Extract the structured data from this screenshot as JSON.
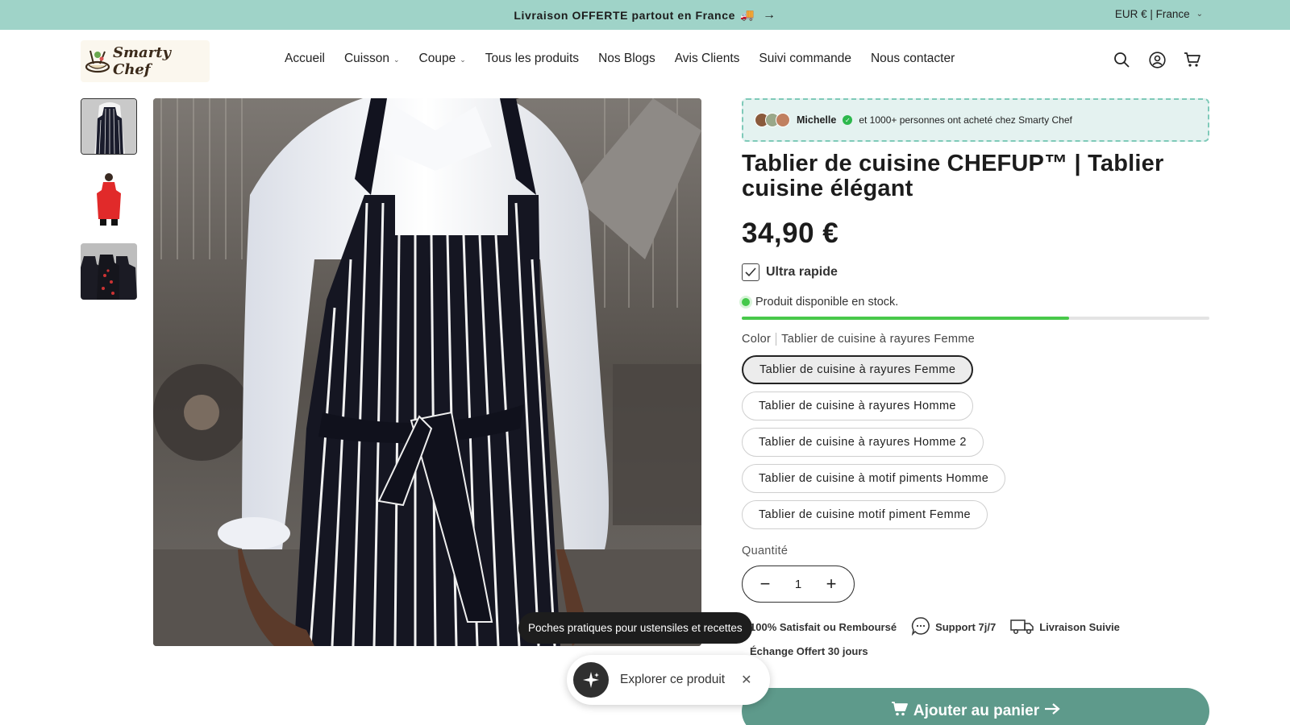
{
  "announcement": {
    "text": "Livraison OFFERTE partout en France",
    "emoji": "🚚",
    "arrow": "→"
  },
  "locale": {
    "label": "EUR € | France"
  },
  "logo": {
    "text": "Smarty Chef"
  },
  "nav": {
    "items": [
      {
        "label": "Accueil",
        "dropdown": false
      },
      {
        "label": "Cuisson",
        "dropdown": true
      },
      {
        "label": "Coupe",
        "dropdown": true
      },
      {
        "label": "Tous les produits",
        "dropdown": false
      },
      {
        "label": "Nos Blogs",
        "dropdown": false
      },
      {
        "label": "Avis Clients",
        "dropdown": false
      },
      {
        "label": "Suivi commande",
        "dropdown": false
      },
      {
        "label": "Nous contacter",
        "dropdown": false
      }
    ]
  },
  "header_icons": [
    "search-icon",
    "account-icon",
    "cart-icon"
  ],
  "product": {
    "social_proof": {
      "name": "Michelle",
      "text": "et 1000+ personnes ont acheté chez Smarty Chef"
    },
    "title": "Tablier de cuisine CHEFUP™ | Tablier cuisine élégant",
    "price": "34,90 €",
    "fast_label": "Ultra rapide",
    "stock_text": "Produit disponible en stock.",
    "stock_level": 0.7,
    "color_label": "Color",
    "selected_color": "Tablier de cuisine à rayures Femme",
    "variants": [
      "Tablier de cuisine à rayures Femme",
      "Tablier de cuisine à rayures Homme",
      "Tablier de cuisine à rayures Homme 2",
      "Tablier de cuisine à motif piments Homme",
      "Tablier de cuisine motif piment Femme"
    ],
    "quantity_label": "Quantité",
    "quantity": "1",
    "badges": {
      "satisfait": "100% Satisfait ou Remboursé",
      "support": "Support 7j/7",
      "livraison": "Livraison Suivie",
      "echange": "Échange Offert 30 jours"
    },
    "add_to_cart": "Ajouter au panier"
  },
  "tooltip": {
    "text": "Poches pratiques pour ustensiles et recettes"
  },
  "explore": {
    "text": "Explorer ce produit"
  },
  "colors": {
    "announce_bg": "#9fd3c8",
    "accent": "#5e9a8b",
    "stock_green": "#48c84a"
  }
}
